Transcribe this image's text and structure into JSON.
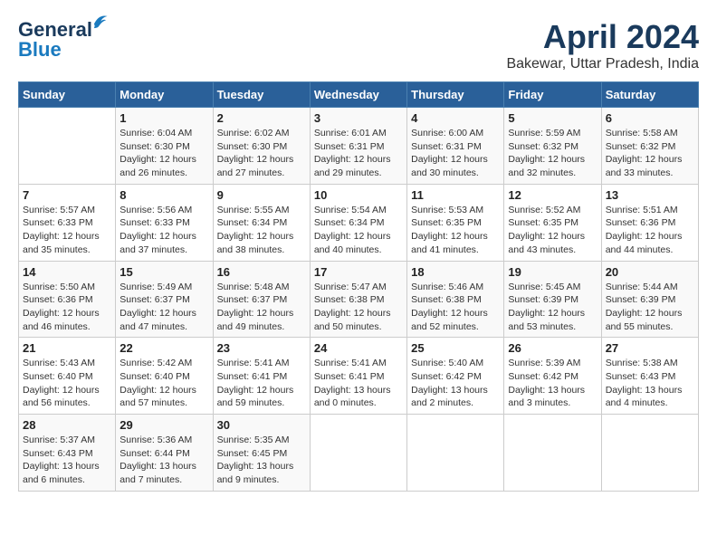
{
  "header": {
    "logo_line1": "General",
    "logo_line2": "Blue",
    "title": "April 2024",
    "subtitle": "Bakewar, Uttar Pradesh, India"
  },
  "days_of_week": [
    "Sunday",
    "Monday",
    "Tuesday",
    "Wednesday",
    "Thursday",
    "Friday",
    "Saturday"
  ],
  "weeks": [
    [
      {
        "num": "",
        "info": ""
      },
      {
        "num": "1",
        "info": "Sunrise: 6:04 AM\nSunset: 6:30 PM\nDaylight: 12 hours\nand 26 minutes."
      },
      {
        "num": "2",
        "info": "Sunrise: 6:02 AM\nSunset: 6:30 PM\nDaylight: 12 hours\nand 27 minutes."
      },
      {
        "num": "3",
        "info": "Sunrise: 6:01 AM\nSunset: 6:31 PM\nDaylight: 12 hours\nand 29 minutes."
      },
      {
        "num": "4",
        "info": "Sunrise: 6:00 AM\nSunset: 6:31 PM\nDaylight: 12 hours\nand 30 minutes."
      },
      {
        "num": "5",
        "info": "Sunrise: 5:59 AM\nSunset: 6:32 PM\nDaylight: 12 hours\nand 32 minutes."
      },
      {
        "num": "6",
        "info": "Sunrise: 5:58 AM\nSunset: 6:32 PM\nDaylight: 12 hours\nand 33 minutes."
      }
    ],
    [
      {
        "num": "7",
        "info": "Sunrise: 5:57 AM\nSunset: 6:33 PM\nDaylight: 12 hours\nand 35 minutes."
      },
      {
        "num": "8",
        "info": "Sunrise: 5:56 AM\nSunset: 6:33 PM\nDaylight: 12 hours\nand 37 minutes."
      },
      {
        "num": "9",
        "info": "Sunrise: 5:55 AM\nSunset: 6:34 PM\nDaylight: 12 hours\nand 38 minutes."
      },
      {
        "num": "10",
        "info": "Sunrise: 5:54 AM\nSunset: 6:34 PM\nDaylight: 12 hours\nand 40 minutes."
      },
      {
        "num": "11",
        "info": "Sunrise: 5:53 AM\nSunset: 6:35 PM\nDaylight: 12 hours\nand 41 minutes."
      },
      {
        "num": "12",
        "info": "Sunrise: 5:52 AM\nSunset: 6:35 PM\nDaylight: 12 hours\nand 43 minutes."
      },
      {
        "num": "13",
        "info": "Sunrise: 5:51 AM\nSunset: 6:36 PM\nDaylight: 12 hours\nand 44 minutes."
      }
    ],
    [
      {
        "num": "14",
        "info": "Sunrise: 5:50 AM\nSunset: 6:36 PM\nDaylight: 12 hours\nand 46 minutes."
      },
      {
        "num": "15",
        "info": "Sunrise: 5:49 AM\nSunset: 6:37 PM\nDaylight: 12 hours\nand 47 minutes."
      },
      {
        "num": "16",
        "info": "Sunrise: 5:48 AM\nSunset: 6:37 PM\nDaylight: 12 hours\nand 49 minutes."
      },
      {
        "num": "17",
        "info": "Sunrise: 5:47 AM\nSunset: 6:38 PM\nDaylight: 12 hours\nand 50 minutes."
      },
      {
        "num": "18",
        "info": "Sunrise: 5:46 AM\nSunset: 6:38 PM\nDaylight: 12 hours\nand 52 minutes."
      },
      {
        "num": "19",
        "info": "Sunrise: 5:45 AM\nSunset: 6:39 PM\nDaylight: 12 hours\nand 53 minutes."
      },
      {
        "num": "20",
        "info": "Sunrise: 5:44 AM\nSunset: 6:39 PM\nDaylight: 12 hours\nand 55 minutes."
      }
    ],
    [
      {
        "num": "21",
        "info": "Sunrise: 5:43 AM\nSunset: 6:40 PM\nDaylight: 12 hours\nand 56 minutes."
      },
      {
        "num": "22",
        "info": "Sunrise: 5:42 AM\nSunset: 6:40 PM\nDaylight: 12 hours\nand 57 minutes."
      },
      {
        "num": "23",
        "info": "Sunrise: 5:41 AM\nSunset: 6:41 PM\nDaylight: 12 hours\nand 59 minutes."
      },
      {
        "num": "24",
        "info": "Sunrise: 5:41 AM\nSunset: 6:41 PM\nDaylight: 13 hours\nand 0 minutes."
      },
      {
        "num": "25",
        "info": "Sunrise: 5:40 AM\nSunset: 6:42 PM\nDaylight: 13 hours\nand 2 minutes."
      },
      {
        "num": "26",
        "info": "Sunrise: 5:39 AM\nSunset: 6:42 PM\nDaylight: 13 hours\nand 3 minutes."
      },
      {
        "num": "27",
        "info": "Sunrise: 5:38 AM\nSunset: 6:43 PM\nDaylight: 13 hours\nand 4 minutes."
      }
    ],
    [
      {
        "num": "28",
        "info": "Sunrise: 5:37 AM\nSunset: 6:43 PM\nDaylight: 13 hours\nand 6 minutes."
      },
      {
        "num": "29",
        "info": "Sunrise: 5:36 AM\nSunset: 6:44 PM\nDaylight: 13 hours\nand 7 minutes."
      },
      {
        "num": "30",
        "info": "Sunrise: 5:35 AM\nSunset: 6:45 PM\nDaylight: 13 hours\nand 9 minutes."
      },
      {
        "num": "",
        "info": ""
      },
      {
        "num": "",
        "info": ""
      },
      {
        "num": "",
        "info": ""
      },
      {
        "num": "",
        "info": ""
      }
    ]
  ]
}
